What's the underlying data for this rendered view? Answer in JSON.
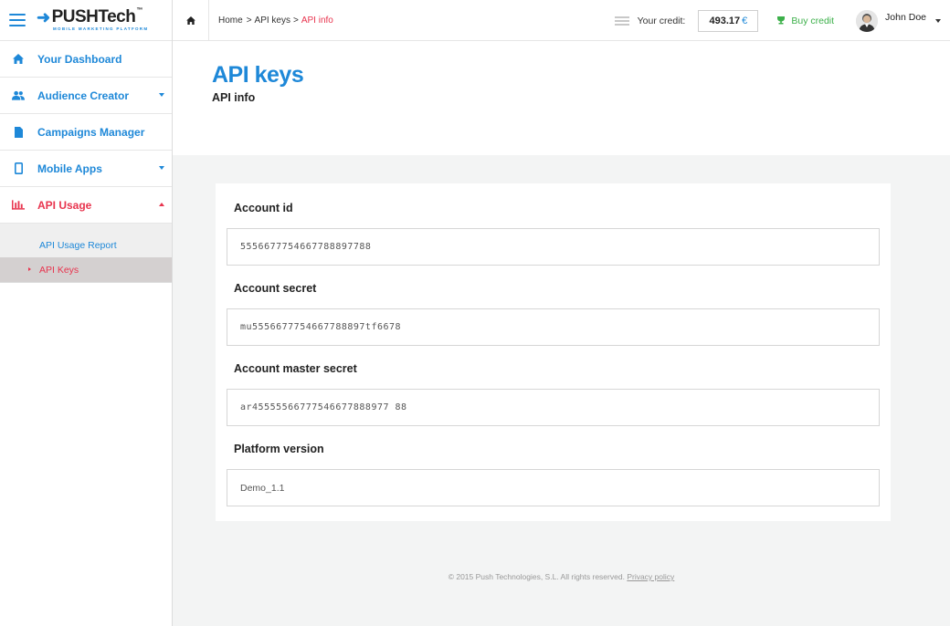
{
  "brand": {
    "name": "PUSHTech",
    "trademark": "™",
    "tagline": "MOBILE MARKETING PLATFORM"
  },
  "sidebar": {
    "items": [
      {
        "label": "Your Dashboard",
        "icon": "home-icon"
      },
      {
        "label": "Audience Creator",
        "icon": "users-icon"
      },
      {
        "label": "Campaigns Manager",
        "icon": "document-icon"
      },
      {
        "label": "Mobile Apps",
        "icon": "mobile-icon"
      },
      {
        "label": "API Usage",
        "icon": "bar-chart-icon"
      }
    ],
    "subitems": [
      {
        "label": "API Usage Report"
      },
      {
        "label": "API Keys"
      }
    ]
  },
  "breadcrumb": {
    "home": "Home",
    "sep1": ">",
    "api_keys": "API keys",
    "sep2": ">",
    "current": "API info"
  },
  "topbar": {
    "credit_label": "Your credit:",
    "credit_value": "493.17",
    "currency": "€",
    "buy_credit": "Buy credit",
    "user_name": "John Doe"
  },
  "page": {
    "title": "API keys",
    "subtitle": "API info"
  },
  "fields": [
    {
      "label": "Account id",
      "value": "5556677754667788897788"
    },
    {
      "label": "Account secret",
      "value": "mu5556677754667788897tf6678"
    },
    {
      "label": "Account master secret",
      "value": "ar45555566777546677888977 88"
    },
    {
      "label": "Platform version",
      "value": "Demo_1.1"
    }
  ],
  "footer": {
    "text": "© 2015 Push Technologies, S.L. All rights reserved.",
    "link": "Privacy policy"
  },
  "colors": {
    "accent": "#1e88d8",
    "active": "#e8344e",
    "buy": "#3cb04a"
  }
}
